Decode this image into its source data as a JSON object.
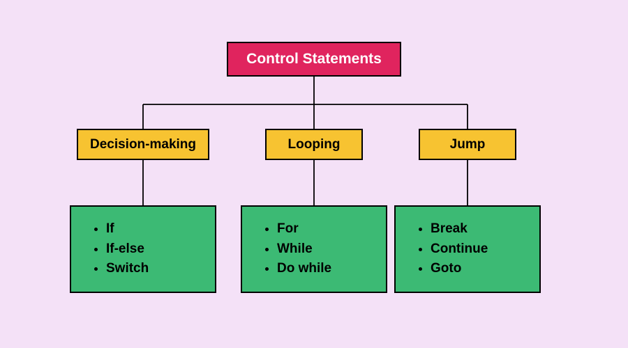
{
  "root": {
    "label": "Control Statements"
  },
  "categories": [
    {
      "label": "Decision-making",
      "items": [
        "If",
        "If-else",
        "Switch"
      ]
    },
    {
      "label": "Looping",
      "items": [
        "For",
        "While",
        "Do while"
      ]
    },
    {
      "label": "Jump",
      "items": [
        "Break",
        "Continue",
        "Goto"
      ]
    }
  ],
  "colors": {
    "background": "#f4e1f7",
    "root": "#e0245e",
    "category": "#f7c331",
    "items": "#3cba74"
  }
}
